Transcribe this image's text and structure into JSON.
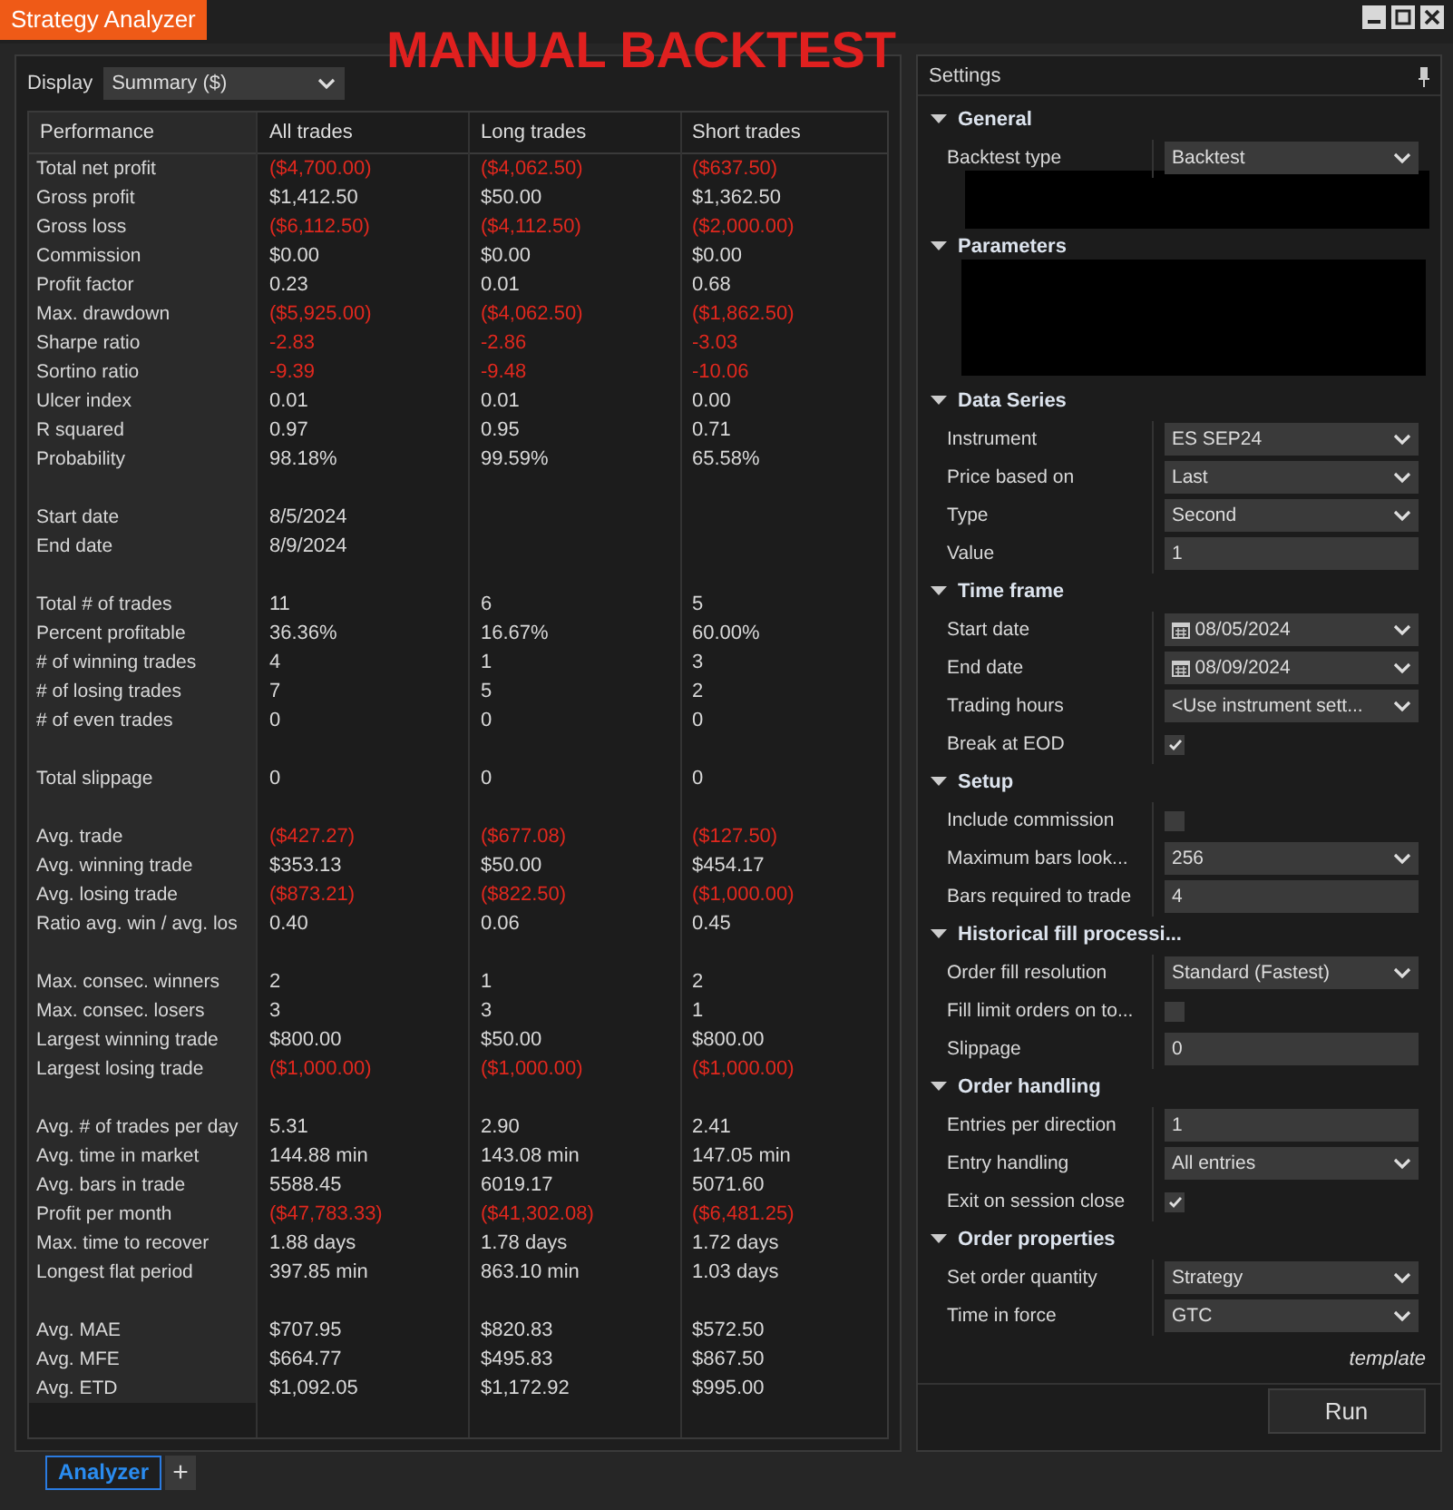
{
  "window": {
    "title": "Strategy Analyzer"
  },
  "overlay_caption": "MANUAL BACKTEST",
  "display": {
    "label": "Display",
    "value": "Summary ($)"
  },
  "table": {
    "columns": [
      "Performance",
      "All trades",
      "Long trades",
      "Short trades"
    ],
    "groups": [
      [
        {
          "label": "Total net profit",
          "negative": true,
          "cells": [
            "($4,700.00)",
            "($4,062.50)",
            "($637.50)"
          ]
        },
        {
          "label": "Gross profit",
          "negative": false,
          "cells": [
            "$1,412.50",
            "$50.00",
            "$1,362.50"
          ]
        },
        {
          "label": "Gross loss",
          "negative": true,
          "cells": [
            "($6,112.50)",
            "($4,112.50)",
            "($2,000.00)"
          ]
        },
        {
          "label": "Commission",
          "negative": false,
          "cells": [
            "$0.00",
            "$0.00",
            "$0.00"
          ]
        },
        {
          "label": "Profit factor",
          "negative": false,
          "cells": [
            "0.23",
            "0.01",
            "0.68"
          ]
        },
        {
          "label": "Max. drawdown",
          "negative": true,
          "cells": [
            "($5,925.00)",
            "($4,062.50)",
            "($1,862.50)"
          ]
        },
        {
          "label": "Sharpe ratio",
          "negative": true,
          "cells": [
            "-2.83",
            "-2.86",
            "-3.03"
          ]
        },
        {
          "label": "Sortino ratio",
          "negative": true,
          "cells": [
            "-9.39",
            "-9.48",
            "-10.06"
          ]
        },
        {
          "label": "Ulcer index",
          "negative": false,
          "cells": [
            "0.01",
            "0.01",
            "0.00"
          ]
        },
        {
          "label": "R squared",
          "negative": false,
          "cells": [
            "0.97",
            "0.95",
            "0.71"
          ]
        },
        {
          "label": "Probability",
          "negative": false,
          "cells": [
            "98.18%",
            "99.59%",
            "65.58%"
          ]
        }
      ],
      [
        {
          "label": "Start date",
          "negative": false,
          "cells": [
            "8/5/2024"
          ]
        },
        {
          "label": "End date",
          "negative": false,
          "cells": [
            "8/9/2024"
          ]
        }
      ],
      [
        {
          "label": "Total # of trades",
          "negative": false,
          "cells": [
            "11",
            "6",
            "5"
          ]
        },
        {
          "label": "Percent profitable",
          "negative": false,
          "cells": [
            "36.36%",
            "16.67%",
            "60.00%"
          ]
        },
        {
          "label": "# of winning trades",
          "negative": false,
          "cells": [
            "4",
            "1",
            "3"
          ]
        },
        {
          "label": "# of losing trades",
          "negative": false,
          "cells": [
            "7",
            "5",
            "2"
          ]
        },
        {
          "label": "# of even trades",
          "negative": false,
          "cells": [
            "0",
            "0",
            "0"
          ]
        }
      ],
      [
        {
          "label": "Total slippage",
          "negative": false,
          "cells": [
            "0",
            "0",
            "0"
          ]
        }
      ],
      [
        {
          "label": "Avg. trade",
          "negative": true,
          "cells": [
            "($427.27)",
            "($677.08)",
            "($127.50)"
          ]
        },
        {
          "label": "Avg. winning trade",
          "negative": false,
          "cells": [
            "$353.13",
            "$50.00",
            "$454.17"
          ]
        },
        {
          "label": "Avg. losing trade",
          "negative": true,
          "cells": [
            "($873.21)",
            "($822.50)",
            "($1,000.00)"
          ]
        },
        {
          "label": "Ratio avg. win / avg. los",
          "negative": false,
          "cells": [
            "0.40",
            "0.06",
            "0.45"
          ]
        }
      ],
      [
        {
          "label": "Max. consec. winners",
          "negative": false,
          "cells": [
            "2",
            "1",
            "2"
          ]
        },
        {
          "label": "Max. consec. losers",
          "negative": false,
          "cells": [
            "3",
            "3",
            "1"
          ]
        },
        {
          "label": "Largest winning trade",
          "negative": false,
          "cells": [
            "$800.00",
            "$50.00",
            "$800.00"
          ]
        },
        {
          "label": "Largest losing trade",
          "negative": true,
          "cells": [
            "($1,000.00)",
            "($1,000.00)",
            "($1,000.00)"
          ]
        }
      ],
      [
        {
          "label": "Avg. # of trades per day",
          "negative": false,
          "cells": [
            "5.31",
            "2.90",
            "2.41"
          ]
        },
        {
          "label": "Avg. time in market",
          "negative": false,
          "cells": [
            "144.88 min",
            "143.08 min",
            "147.05 min"
          ]
        },
        {
          "label": "Avg. bars in trade",
          "negative": false,
          "cells": [
            "5588.45",
            "6019.17",
            "5071.60"
          ]
        },
        {
          "label": "Profit per month",
          "negative": true,
          "cells": [
            "($47,783.33)",
            "($41,302.08)",
            "($6,481.25)"
          ]
        },
        {
          "label": "Max. time to recover",
          "negative": false,
          "cells": [
            "1.88 days",
            "1.78 days",
            "1.72 days"
          ]
        },
        {
          "label": "Longest flat period",
          "negative": false,
          "cells": [
            "397.85 min",
            "863.10 min",
            "1.03 days"
          ]
        }
      ],
      [
        {
          "label": "Avg. MAE",
          "negative": false,
          "cells": [
            "$707.95",
            "$820.83",
            "$572.50"
          ]
        },
        {
          "label": "Avg. MFE",
          "negative": false,
          "cells": [
            "$664.77",
            "$495.83",
            "$867.50"
          ]
        },
        {
          "label": "Avg. ETD",
          "negative": false,
          "cells": [
            "$1,092.05",
            "$1,172.92",
            "$995.00"
          ]
        }
      ]
    ]
  },
  "settings": {
    "title": "Settings",
    "categories": [
      {
        "name": "General",
        "expanded": true,
        "redacted": true,
        "properties": [
          {
            "label": "Backtest type",
            "kind": "select",
            "value": "Backtest"
          }
        ]
      },
      {
        "name": "Parameters",
        "expanded": true,
        "redacted": true
      },
      {
        "name": "Data Series",
        "expanded": true,
        "redacted": false,
        "properties": [
          {
            "label": "Instrument",
            "kind": "select",
            "value": "ES SEP24"
          },
          {
            "label": "Price based on",
            "kind": "select",
            "value": "Last"
          },
          {
            "label": "Type",
            "kind": "select",
            "value": "Second"
          },
          {
            "label": "Value",
            "kind": "input",
            "value": "1"
          }
        ]
      },
      {
        "name": "Time frame",
        "expanded": true,
        "redacted": false,
        "properties": [
          {
            "label": "Start date",
            "kind": "date",
            "value": "08/05/2024"
          },
          {
            "label": "End date",
            "kind": "date",
            "value": "08/09/2024"
          },
          {
            "label": "Trading hours",
            "kind": "select",
            "value": "<Use instrument sett..."
          },
          {
            "label": "Break at EOD",
            "kind": "checkbox",
            "checked": true
          }
        ]
      },
      {
        "name": "Setup",
        "expanded": true,
        "redacted": false,
        "properties": [
          {
            "label": "Include commission",
            "kind": "checkbox",
            "checked": false
          },
          {
            "label": "Maximum bars look...",
            "kind": "select",
            "value": "256"
          },
          {
            "label": "Bars required to trade",
            "kind": "input",
            "value": "4"
          }
        ]
      },
      {
        "name": "Historical fill processi...",
        "expanded": true,
        "redacted": false,
        "properties": [
          {
            "label": "Order fill resolution",
            "kind": "select",
            "value": "Standard (Fastest)"
          },
          {
            "label": "Fill limit orders on to...",
            "kind": "checkbox",
            "checked": false
          },
          {
            "label": "Slippage",
            "kind": "input",
            "value": "0"
          }
        ]
      },
      {
        "name": "Order handling",
        "expanded": true,
        "redacted": false,
        "properties": [
          {
            "label": "Entries per direction",
            "kind": "input",
            "value": "1"
          },
          {
            "label": "Entry handling",
            "kind": "select",
            "value": "All entries"
          },
          {
            "label": "Exit on session close",
            "kind": "checkbox",
            "checked": true
          }
        ]
      },
      {
        "name": "Order properties",
        "expanded": true,
        "redacted": false,
        "properties": [
          {
            "label": "Set order quantity",
            "kind": "select",
            "value": "Strategy"
          },
          {
            "label": "Time in force",
            "kind": "select",
            "value": "GTC"
          }
        ]
      }
    ],
    "footer": "template",
    "run_button": "Run"
  },
  "bottom_tabs": [
    {
      "label": "Analyzer",
      "selected": true
    }
  ],
  "add_tab_button": "+"
}
